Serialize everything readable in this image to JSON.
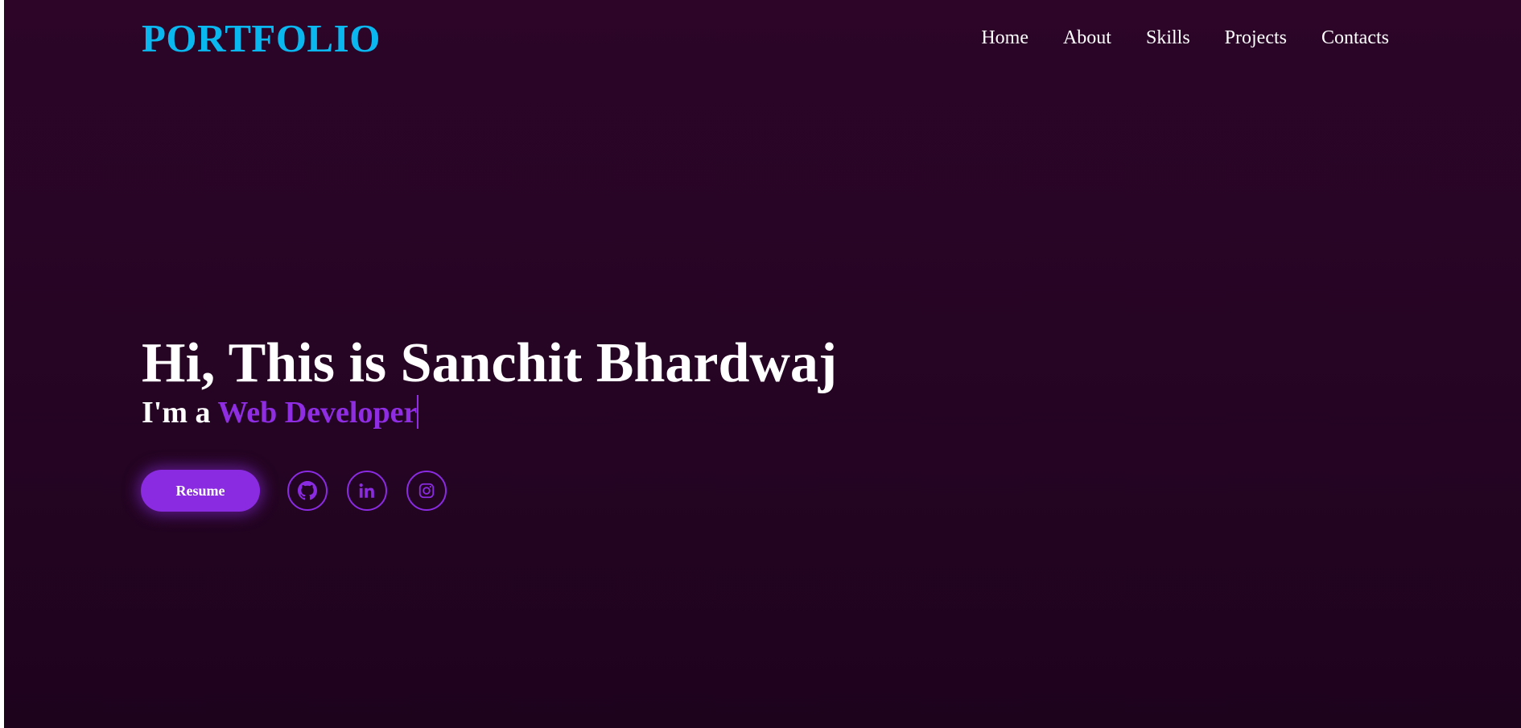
{
  "brand": {
    "logo": "PORTFOLIO",
    "logo_color": "#0ab8ef"
  },
  "nav": {
    "items": [
      {
        "label": "Home"
      },
      {
        "label": "About"
      },
      {
        "label": "Skills"
      },
      {
        "label": "Projects"
      },
      {
        "label": "Contacts"
      }
    ]
  },
  "hero": {
    "title": "Hi, This is Sanchit Bhardwaj",
    "subtitle_prefix": "I'm a ",
    "role": "Web Developer",
    "role_color": "#8e2de2"
  },
  "actions": {
    "resume_label": "Resume",
    "accent_color": "#8a2be2"
  },
  "social": [
    {
      "icon": "github-icon"
    },
    {
      "icon": "linkedin-icon"
    },
    {
      "icon": "instagram-icon"
    }
  ],
  "colors": {
    "background": "#2c0529",
    "text": "#ffffff"
  }
}
